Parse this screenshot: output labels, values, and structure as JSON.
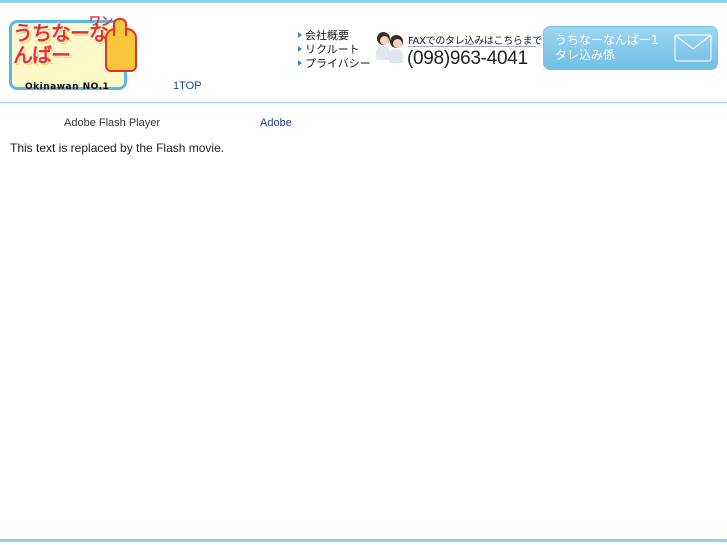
{
  "logo": {
    "japanese_text": "うちなーなんばー",
    "wan_text": "ワン",
    "subtitle": "Okinawan NO.1"
  },
  "top_link": "1TOP",
  "nav": {
    "items": [
      {
        "label": "会社概要"
      },
      {
        "label": "リクルート"
      },
      {
        "label": "プライバシー"
      }
    ]
  },
  "fax": {
    "caption": "FAXでのタレ込みはこちらまで",
    "number": "(098)963-4041"
  },
  "mail_button": {
    "line1": "うちなーなんばー1",
    "line2": "タレ込み係"
  },
  "flash": {
    "label": "Adobe Flash Player",
    "adobe_link": "Adobe",
    "replaced_text": "This text is replaced by the Flash movie."
  },
  "colors": {
    "accent_blue": "#8fd0ec",
    "logo_red": "#e8302a",
    "link_blue": "#1f3f8f"
  }
}
